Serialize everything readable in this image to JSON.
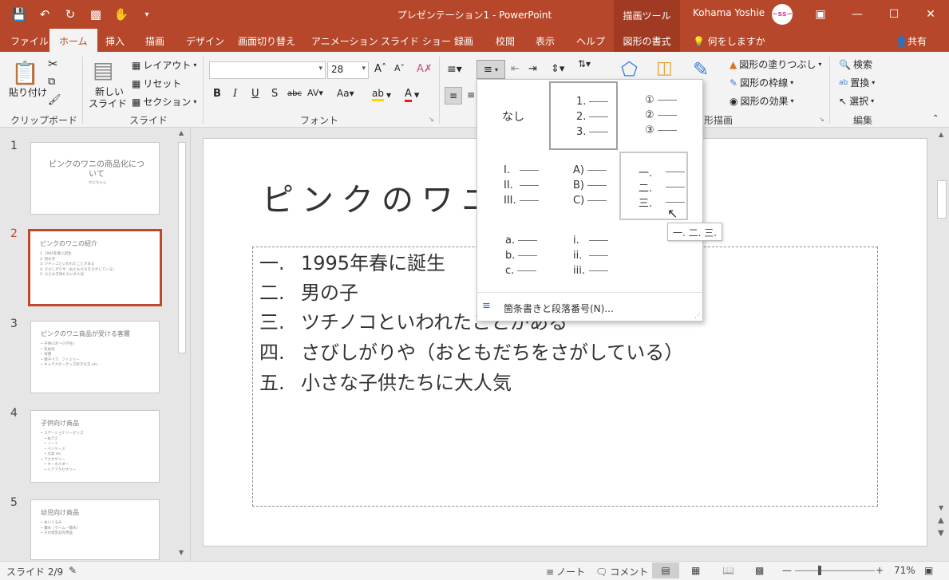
{
  "window": {
    "title": "プレゼンテーション1 - PowerPoint",
    "context_tool": "描画ツール",
    "user": "Kohama Yoshie",
    "avatar_text": "~ss~"
  },
  "tabs": [
    {
      "label": "ファイル"
    },
    {
      "label": "ホーム"
    },
    {
      "label": "挿入"
    },
    {
      "label": "描画"
    },
    {
      "label": "デザイン"
    },
    {
      "label": "画面切り替え"
    },
    {
      "label": "アニメーション"
    },
    {
      "label": "スライド ショー"
    },
    {
      "label": "録画"
    },
    {
      "label": "校閲"
    },
    {
      "label": "表示"
    },
    {
      "label": "ヘルプ"
    },
    {
      "label": "図形の書式"
    }
  ],
  "tellme": "何をしますか",
  "share": "共有",
  "ribbon": {
    "clipboard": {
      "paste": "貼り付け",
      "label": "クリップボード"
    },
    "slides": {
      "new_slide_1": "新しい",
      "new_slide_2": "スライド",
      "layout": "レイアウト",
      "reset": "リセット",
      "section": "セクション",
      "label": "スライド"
    },
    "font": {
      "font_name": "",
      "font_size": "28",
      "label": "フォント"
    },
    "drawing": {
      "fill": "図形の塗りつぶし",
      "outline": "図形の枠線",
      "effect": "図形の効果",
      "label": "形描画"
    },
    "editing": {
      "find": "検索",
      "replace": "置換",
      "select": "選択",
      "label": "編集"
    }
  },
  "gallery": {
    "none": "なし",
    "decimal": [
      "1.",
      "2.",
      "3."
    ],
    "circled": [
      "①",
      "②",
      "③"
    ],
    "roman_upper": [
      "I.",
      "II.",
      "III."
    ],
    "alpha_paren": [
      "A)",
      "B)",
      "C)"
    ],
    "kanji": [
      "一.",
      "二.",
      "三."
    ],
    "alpha_lower": [
      "a.",
      "b.",
      "c."
    ],
    "roman_lower": [
      "i.",
      "ii.",
      "iii."
    ],
    "footer": "箇条書きと段落番号(N)...",
    "tooltip": "一. 二. 三."
  },
  "thumbnails": [
    {
      "num": "1",
      "title": "ピンクのワニの商品化について",
      "body": "わにちゃん"
    },
    {
      "num": "2",
      "title": "ピンクのワニの紹介",
      "body": "1. 1995年春に誕生\n2. 男の子\n3. ツチノコといわれたことがある\n4. さびしがりや（おともだちをさがしている）\n5. 小さな子供たちに大人気"
    },
    {
      "num": "3",
      "title": "ピンクのワニ商品が受ける客層",
      "body": "• 子供(3才〜小学生)\n• 乳幼児\n• 母親\n• 親子ペア、ファミリー\n• キャラクターグッズ好きな方 etc..."
    },
    {
      "num": "4",
      "title": "子供向け商品",
      "body": "• ステーショナリーグッズ\n   • ぬりえ\n   • ノート\n   • ペンケース\n   • 文具 etc\n• アクセサリー\n   • キーホルダー\n   • ヘアアクセサリー"
    },
    {
      "num": "5",
      "title": "幼児向け商品",
      "body": "• ぬいぐるみ\n• 積木（ゲーム・積木）\n• その他乳幼児用品"
    }
  ],
  "slide": {
    "title": "ピンクのワニ",
    "items": [
      {
        "num": "一.",
        "text": "1995年春に誕生"
      },
      {
        "num": "二.",
        "text": "男の子"
      },
      {
        "num": "三.",
        "text": "ツチノコといわれたことがある"
      },
      {
        "num": "四.",
        "text": "さびしがりや（おともだちをさがしている）"
      },
      {
        "num": "五.",
        "text": "小さな子供たちに大人気"
      }
    ]
  },
  "status": {
    "slide_info": "スライド 2/9",
    "notes": "ノート",
    "comments": "コメント",
    "zoom": "71%"
  },
  "colors": {
    "accent": "#b7472a",
    "ribbon_bg": "#f3f3f3",
    "selected_border": "#c0472a"
  }
}
